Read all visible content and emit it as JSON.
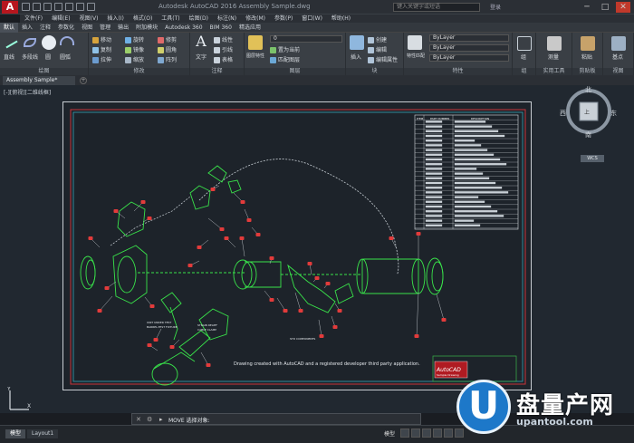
{
  "window": {
    "title": "Autodesk AutoCAD 2016   Assembly Sample.dwg",
    "search_placeholder": "键入关键字或短语",
    "user": "登录",
    "minimize": "─",
    "maximize": "□",
    "close": "✕"
  },
  "menu": [
    "文件(F)",
    "编辑(E)",
    "视图(V)",
    "插入(I)",
    "格式(O)",
    "工具(T)",
    "绘图(D)",
    "标注(N)",
    "修改(M)",
    "参数(P)",
    "窗口(W)",
    "帮助(H)"
  ],
  "ribbon_tabs": [
    "默认",
    "插入",
    "注释",
    "参数化",
    "视图",
    "管理",
    "输出",
    "附加模块",
    "Autodesk 360",
    "BIM 360",
    "精选应用"
  ],
  "panels": {
    "draw": {
      "title": "绘图",
      "line": "直线",
      "polyline": "多段线",
      "circle": "圆",
      "arc": "圆弧"
    },
    "modify": {
      "title": "修改",
      "move": "移动",
      "rotate": "旋转",
      "trim": "修剪",
      "copy": "复制",
      "mirror": "镜像",
      "fillet": "圆角",
      "stretch": "拉伸",
      "scale": "缩放",
      "array": "阵列"
    },
    "annotation": {
      "title": "注释",
      "text": "文字",
      "linear": "线性",
      "leader": "引线",
      "table": "表格"
    },
    "layers": {
      "title": "图层",
      "layer_props": "图层特性",
      "layer_value": "0",
      "make_current": "置为当前",
      "match": "匹配图层"
    },
    "block": {
      "title": "块",
      "insert": "插入",
      "create": "创建",
      "edit": "编辑",
      "edit_attr": "编辑属性"
    },
    "properties": {
      "title": "特性",
      "match": "特性匹配",
      "color": "ByLayer",
      "linetype": "ByLayer",
      "lineweight": "ByLayer"
    },
    "groups": {
      "title": "组",
      "group": "组"
    },
    "utilities": {
      "title": "实用工具",
      "measure": "测量"
    },
    "clipboard": {
      "title": "剪贴板",
      "paste": "粘贴"
    },
    "view": {
      "title": "视图",
      "base": "基点"
    }
  },
  "document_tab": "Assembly Sample*",
  "viewport_label": "[-][俯视][二维线框]",
  "drawing": {
    "note": "Drawing created with AutoCAD and a registered developer third party application.",
    "title_block_logo": "AutoCAD",
    "title_block_sub": "Sample Drawing",
    "parts_header": [
      "ITEM",
      "PART NUMBER",
      "DESCRIPTION"
    ],
    "callouts": [
      "UNIT UNDER TEST",
      "BARREL-TEST FIXTURE",
      "STRAIN RELIEF",
      "CABLE CLAMP",
      "STD COMPONENTS"
    ]
  },
  "viewcube": {
    "north": "北",
    "south": "南",
    "east": "东",
    "west": "西",
    "top": "上",
    "wcs": "WCS"
  },
  "command": {
    "text": "MOVE 选择对象:",
    "prompt": "▸"
  },
  "layout_tabs": [
    "模型",
    "Layout1"
  ],
  "status": {
    "model": "模型"
  },
  "watermark": {
    "letter": "U",
    "main": "盘量产网",
    "url": "upantool.com"
  },
  "colors": {
    "accent": "#1d78c9",
    "drawing_green": "#39e34a",
    "callout_red": "#e23b3b",
    "border_red": "#c8353b"
  }
}
